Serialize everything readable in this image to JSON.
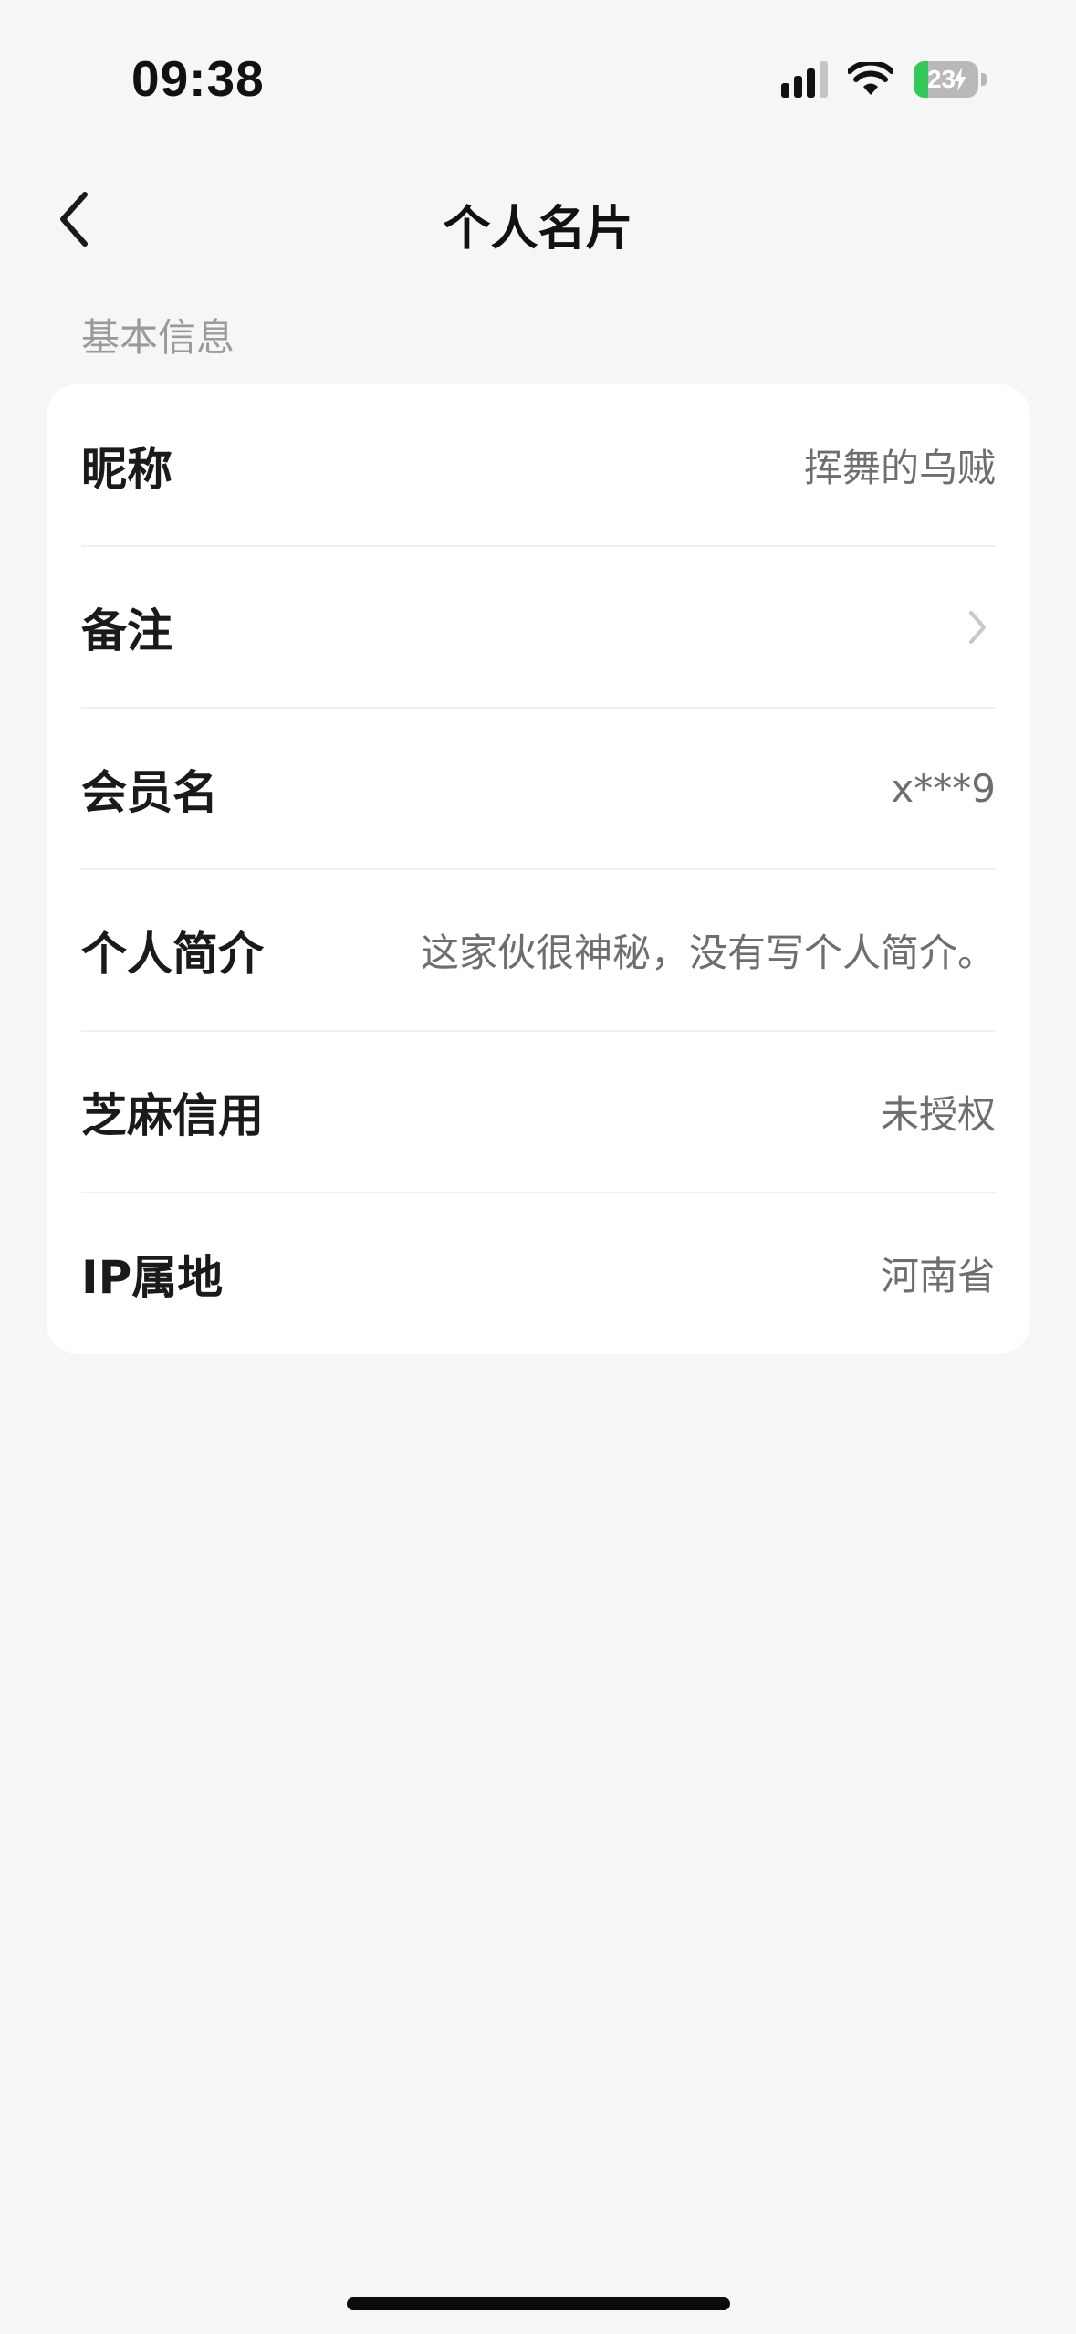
{
  "status_bar": {
    "time": "09:38",
    "battery_level": "23",
    "battery_fraction": 0.23,
    "battery_charging": true,
    "signal_bars_active": 3,
    "signal_bars_total": 4,
    "icons": [
      "cellular-signal-icon",
      "wifi-icon",
      "battery-icon",
      "charging-bolt-icon"
    ]
  },
  "nav": {
    "back_icon": "chevron-left-icon",
    "title": "个人名片"
  },
  "section": {
    "label": "基本信息"
  },
  "rows": [
    {
      "label": "昵称",
      "value": "挥舞的乌贼"
    },
    {
      "label": "备注",
      "value": "",
      "icon": "chevron-right-icon"
    },
    {
      "label": "会员名",
      "value": "x***9"
    },
    {
      "label": "个人简介",
      "value": "这家伙很神秘，没有写个人简介。"
    },
    {
      "label": "芝麻信用",
      "value": "未授权"
    },
    {
      "label": "IP属地",
      "value": "河南省"
    }
  ],
  "colors": {
    "background": "#f6f6f6",
    "card": "#ffffff",
    "label_text": "#1a1a1a",
    "value_text": "#6e6e6e",
    "section_label": "#9a9a9a",
    "battery_fill": "#34c759"
  }
}
